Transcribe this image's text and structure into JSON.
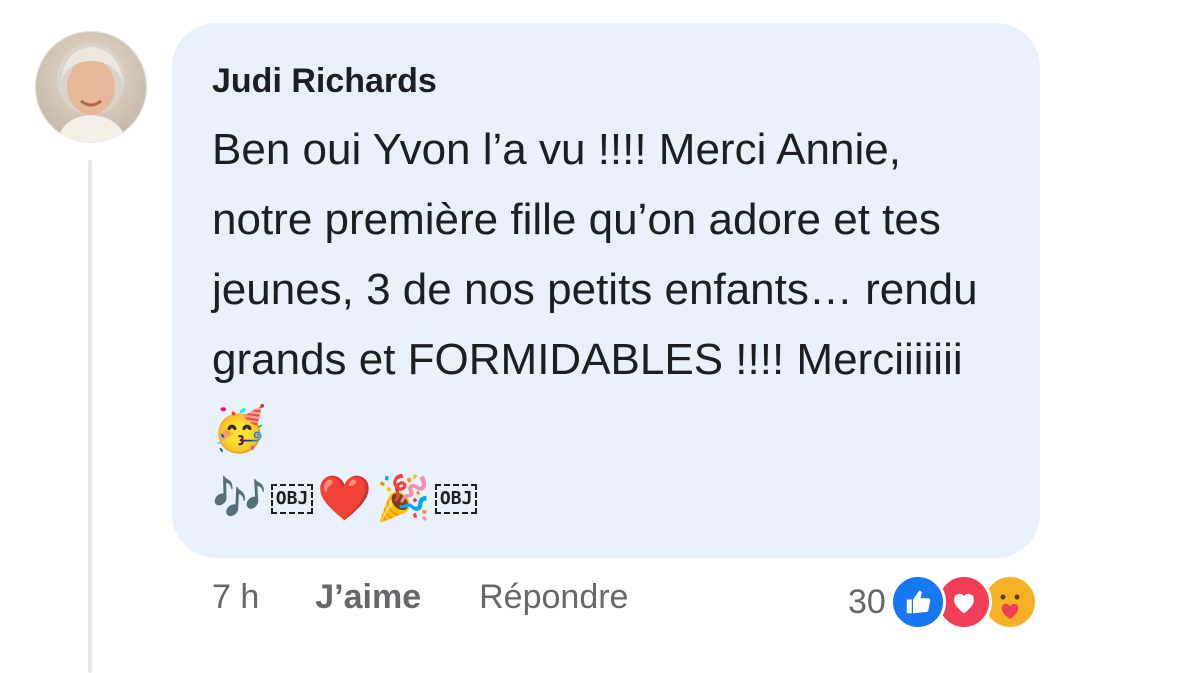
{
  "comment": {
    "author": "Judi Richards",
    "text": "Ben oui Yvon l’a vu !!!! Merci Annie, notre première fille qu’on adore et tes jeunes, 3 de nos petits enfants… rendu grands et FORMIDABLES !!!! Merciiiiiii 🥳",
    "emoji_line": {
      "notes": "🎶",
      "obj1": "OBJ",
      "heart": "❤️",
      "popper": "🎉",
      "obj2": "OBJ"
    }
  },
  "actions": {
    "time": "7 h",
    "like_label": "J’aime",
    "reply_label": "Répondre"
  },
  "reactions": {
    "count": "30",
    "icons": [
      "like-icon",
      "love-icon",
      "care-icon"
    ]
  },
  "colors": {
    "bubble": "#e8f1fc",
    "like": "#1877f2",
    "love": "#f33e58",
    "care": "#f7b125"
  }
}
